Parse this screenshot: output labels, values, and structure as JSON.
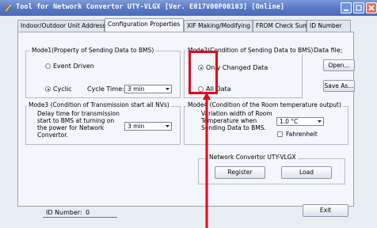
{
  "window": {
    "title": "Tool for Network Convertor UTY-VLGX [Ver. E017V00P00103] [Online]",
    "minimize_icon": "minimize-icon",
    "maximize_icon": "maximize-icon",
    "close_icon": "close-icon"
  },
  "tabs": [
    {
      "label": "Indoor/Outdoor Unit Address"
    },
    {
      "label": "Configuration Properties"
    },
    {
      "label": "XIF Making/Modifying"
    },
    {
      "label": "FROM Check Sum"
    },
    {
      "label": "ID Number"
    }
  ],
  "mode1": {
    "title": "Mode1(Property of Sending Data to BMS)",
    "event_driven": "Event Driven",
    "cyclic": "Cyclic",
    "cycle_time_label": "Cycle Time:",
    "cycle_time_value": "3 min",
    "selected": "cyclic"
  },
  "mode2": {
    "title": "Mode2(Condition of Sending Data to BMS)",
    "only_changed": "Only Changed Data",
    "all_data": "All Data",
    "selected": "only_changed"
  },
  "data_file": {
    "label": "Data file;",
    "open": "Open...",
    "save_as": "Save As..."
  },
  "mode3": {
    "title": "Mode3 (Condition of Transmission start all NVs)",
    "line1": "Delay time for transmission",
    "line2": "start to BMS at turning on",
    "line3": "the power for Network",
    "line4": "Convertor.",
    "value": "3 min"
  },
  "mode4": {
    "title": "Mode4 (Condition of the Room temperature output)",
    "line1": "Variation width of Room",
    "line2": "Temperature when",
    "line3": "Sending Data to BMS.",
    "value": "1.0 °C",
    "fahrenheit": "Fahrenheit"
  },
  "network": {
    "title": "Network Convertor UTY-VLGX",
    "register": "Register",
    "load": "Load"
  },
  "footer": {
    "id_label": "ID Number:",
    "id_value": "0",
    "exit": "Exit"
  },
  "annotation": {
    "color": "#e5001a"
  }
}
